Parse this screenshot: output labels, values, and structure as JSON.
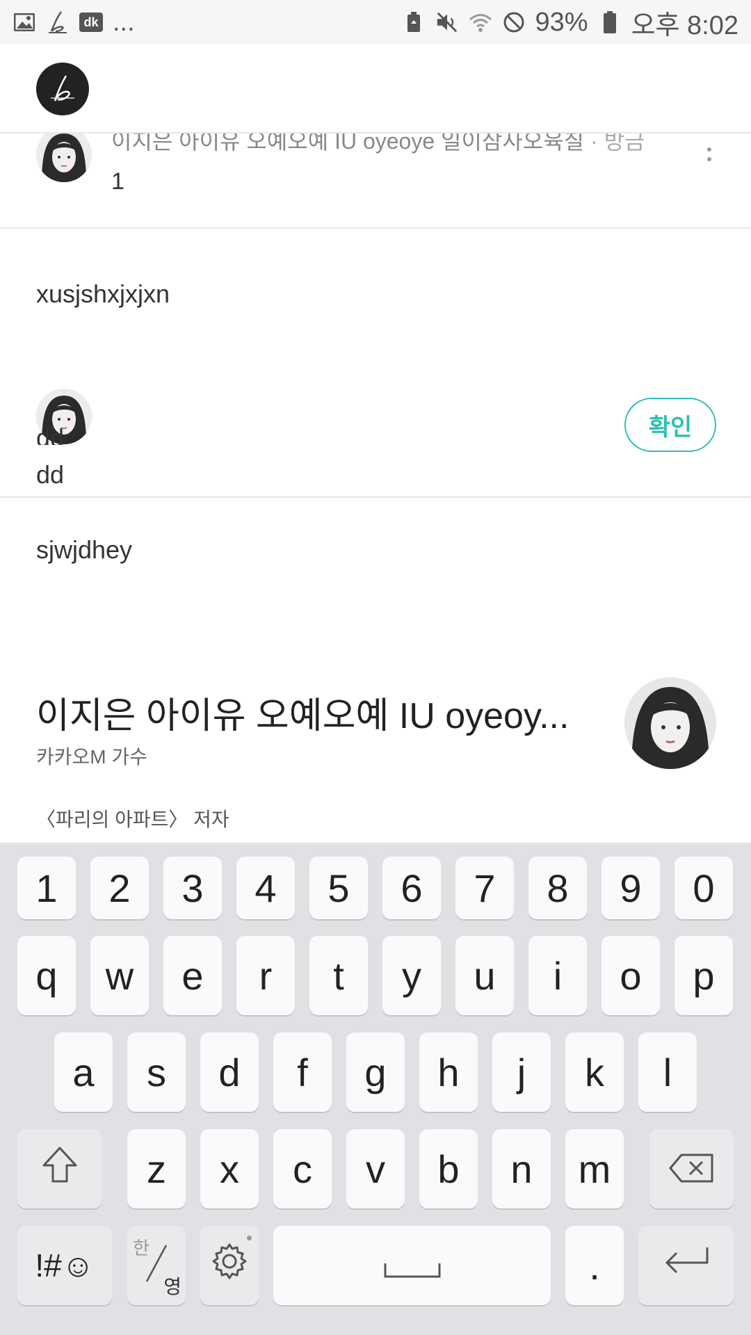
{
  "status_bar": {
    "left_icons": [
      "image-icon",
      "pen-icon",
      "dk-app-icon"
    ],
    "dk_label": "dk",
    "overflow": "...",
    "battery": "93%",
    "time": "오후 8:02"
  },
  "header": {
    "logo_icon": "brunch-logo-icon"
  },
  "top_comment": {
    "cut_title": "이지은 아이유 오예오예 IU oyeoye 일이삼사오육칠",
    "cut_time": "방금",
    "text": "1"
  },
  "blocks": {
    "para1": "xusjshxjxjxn",
    "reply_cut": "dd",
    "reply_text": "dd",
    "confirm_label": "확인",
    "para2": "sjwjdhey"
  },
  "author": {
    "name": "이지은 아이유 오예오예 IU oyeoy...",
    "desc": "카카오M 가수",
    "book_prefix": "〈",
    "book_title": "파리의 아파트",
    "book_suffix": "〉 저자"
  },
  "keyboard": {
    "numbers": [
      "1",
      "2",
      "3",
      "4",
      "5",
      "6",
      "7",
      "8",
      "9",
      "0"
    ],
    "row1": [
      "q",
      "w",
      "e",
      "r",
      "t",
      "y",
      "u",
      "i",
      "o",
      "p"
    ],
    "row2": [
      "a",
      "s",
      "d",
      "f",
      "g",
      "h",
      "j",
      "k",
      "l"
    ],
    "row3": [
      "z",
      "x",
      "c",
      "v",
      "b",
      "n",
      "m"
    ],
    "symbols": "!#☺",
    "lang_top": "한",
    "lang_bottom": "영",
    "period": ".",
    "icons": [
      "shift-icon",
      "backspace-icon",
      "settings-icon",
      "space-icon",
      "enter-icon"
    ]
  },
  "colors": {
    "accent": "#2cbfb3",
    "keyboard_bg": "#dfe1e5"
  }
}
